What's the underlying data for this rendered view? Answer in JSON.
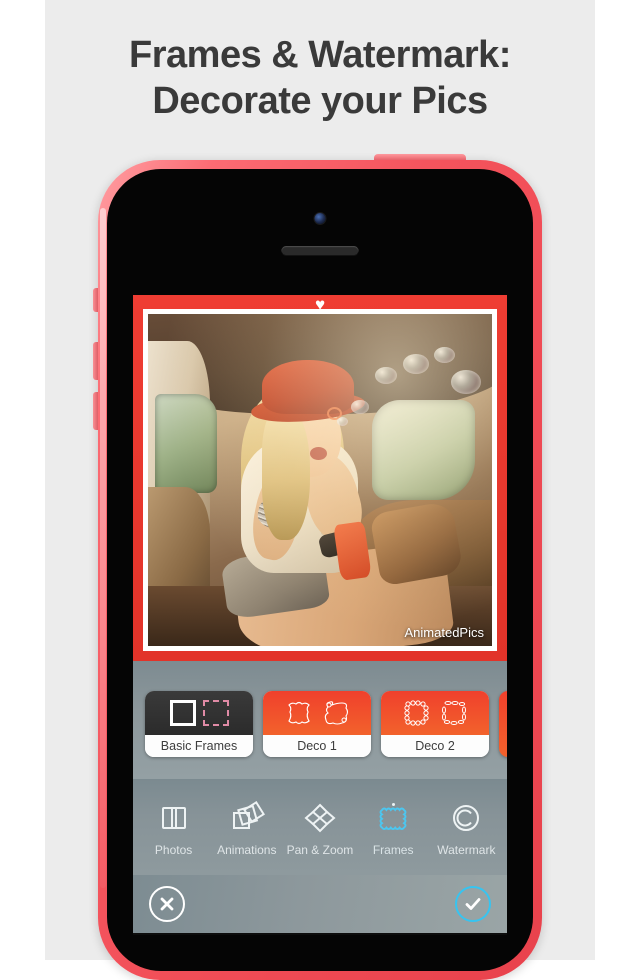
{
  "headline": {
    "line1": "Frames & Watermark:",
    "line2": "Decorate your Pics"
  },
  "device": {
    "name": "iphone-5c-pink",
    "shell_color": "#f0505a",
    "screen_bg": "#111111"
  },
  "photo": {
    "description": "Blonde woman wearing a red hat blowing soap bubbles while sitting in the open trunk of a vintage car",
    "watermark_text": "AnimatedPics",
    "frame": {
      "name": "heart-top-red-frame",
      "color": "#e8392f",
      "inner_border_color": "#ffffff",
      "ornament": "♥"
    }
  },
  "frame_chooser": {
    "items": [
      {
        "label": "Basic Frames",
        "style": "dark",
        "selected": true
      },
      {
        "label": "Deco 1",
        "style": "red",
        "selected": false
      },
      {
        "label": "Deco 2",
        "style": "red",
        "selected": false
      }
    ],
    "has_partial_next": true
  },
  "toolbar": {
    "items": [
      {
        "label": "Photos",
        "icon": "photos-icon",
        "active": false
      },
      {
        "label": "Animations",
        "icon": "animations-icon",
        "active": false
      },
      {
        "label": "Pan & Zoom",
        "icon": "pan-zoom-icon",
        "active": false
      },
      {
        "label": "Frames",
        "icon": "frames-icon",
        "active": true
      },
      {
        "label": "Watermark",
        "icon": "watermark-icon",
        "active": false
      }
    ],
    "active_color": "#4cc6ef",
    "inactive_color": "#e3e9eb"
  },
  "actions": {
    "cancel": {
      "icon": "close-circle-icon",
      "color": "#ffffff"
    },
    "confirm": {
      "icon": "check-circle-icon",
      "color": "#37c4f0"
    }
  },
  "colors": {
    "page_background": "#ececec",
    "headline": "#3a3a3a",
    "accent_red": "#f0402c",
    "accent_cyan": "#37c4f0"
  }
}
